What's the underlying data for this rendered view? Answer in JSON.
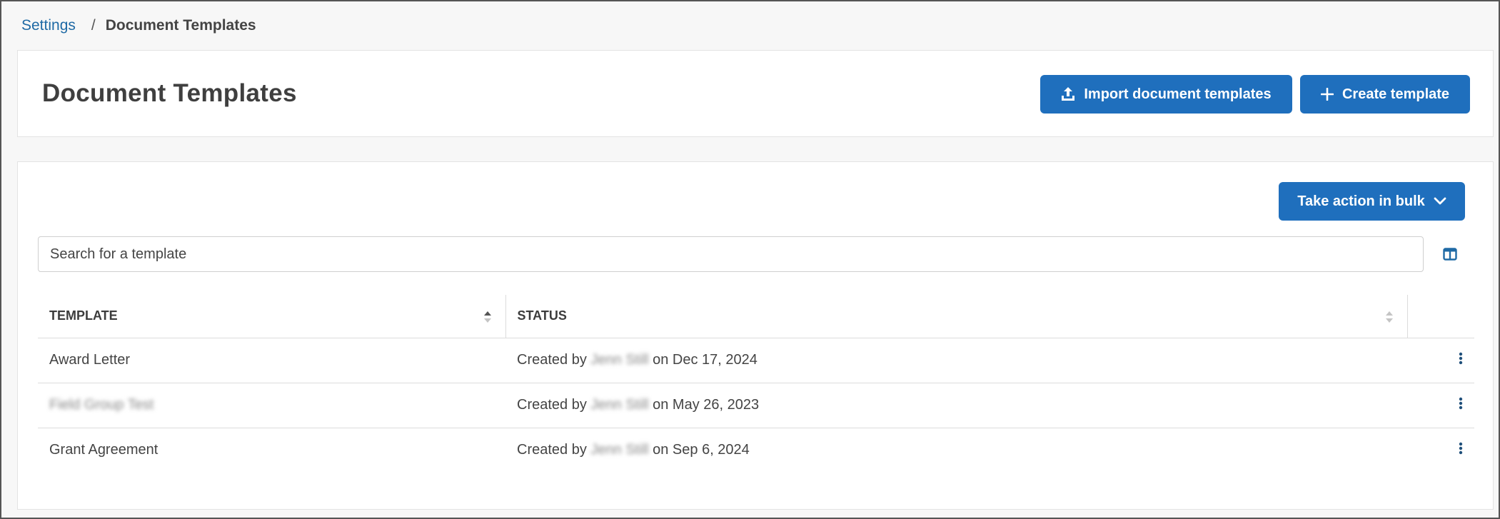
{
  "breadcrumb": {
    "parent": "Settings",
    "separator": "/",
    "current": "Document Templates"
  },
  "header": {
    "title": "Document Templates",
    "import_label": "Import document templates",
    "create_label": "Create template"
  },
  "toolbar": {
    "bulk_label": "Take action in bulk",
    "search_placeholder": "Search for a template"
  },
  "table": {
    "columns": [
      "Template",
      "Status"
    ],
    "rows": [
      {
        "template": "Award Letter",
        "status_prefix": "Created by",
        "creator": "Jenn Still",
        "status_suffix": "on Dec 17, 2024"
      },
      {
        "template": "Field Group Test",
        "status_prefix": "Created by",
        "creator": "Jenn Still",
        "status_suffix": "on May 26, 2023"
      },
      {
        "template": "Grant Agreement",
        "status_prefix": "Created by",
        "creator": "Jenn Still",
        "status_suffix": "on Sep 6, 2024"
      }
    ]
  },
  "colors": {
    "primary": "#1f6fbd",
    "link": "#1f6aa5"
  },
  "icons": {
    "import": "upload-icon",
    "create": "plus-icon",
    "bulk": "chevron-down-icon",
    "columns": "columns-icon",
    "sort": "sort-icon",
    "row_menu": "kebab-menu-icon"
  }
}
